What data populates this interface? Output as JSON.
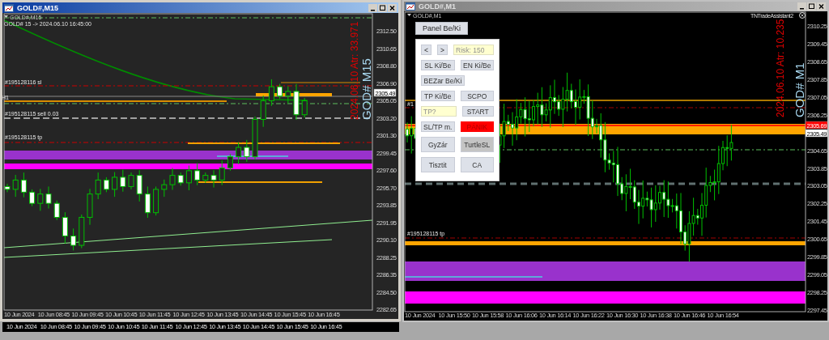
{
  "windows": [
    {
      "kind": "m15",
      "title": "GOLD#,M15",
      "active": true,
      "chart_label": "GOLD#,M15",
      "info": "GOLD# 15 -> 2024.06.10 16:45:00",
      "order_labels": [
        "#195128116 sl",
        "H1",
        "#195128115 sell 0.03",
        "#195128115 tp"
      ],
      "atr_text": "2024.06.10 Atr: 33.971",
      "symbol_text": "GOD# M15",
      "price_labels": [
        {
          "kind": "bid",
          "text": "2305.49"
        }
      ],
      "price_ticks": [
        "2312.50",
        "2310.65",
        "2308.80",
        "2306.90",
        "2305.05",
        "2303.20",
        "2301.30",
        "2299.45",
        "2297.60",
        "2295.70",
        "2293.85",
        "2291.95",
        "2290.10",
        "2288.25",
        "2286.35",
        "2284.50",
        "2282.65"
      ],
      "time_ticks": [
        "10 Jun 2024",
        "10 Jun 08:45",
        "10 Jun 09:45",
        "10 Jun 10:45",
        "10 Jun 11:45",
        "10 Jun 12:45",
        "10 Jun 13:45",
        "10 Jun 14:45",
        "10 Jun 15:45",
        "10 Jun 16:45"
      ]
    },
    {
      "kind": "m1",
      "title": "GOLD#,M1",
      "active": false,
      "chart_label": "GOLD#,M1",
      "assistant_label": "TNTradeAssistant2",
      "order_labels": [
        "#1",
        "#195128115 tp"
      ],
      "atr_text": "2024.06.10 Atr: 10.235",
      "symbol_text": "GOD# M1",
      "price_labels": [
        {
          "kind": "ask",
          "text": "2305.69"
        },
        {
          "kind": "bid",
          "text": "2305.49"
        }
      ],
      "price_ticks": [
        "2310.25",
        "2309.45",
        "2308.65",
        "2307.85",
        "2307.05",
        "2306.25",
        "2304.65",
        "2303.85",
        "2303.05",
        "2302.25",
        "2301.45",
        "2300.65",
        "2299.85",
        "2299.05",
        "2298.25",
        "2297.45"
      ],
      "time_ticks": [
        "10 Jun 2024",
        "10 Jun 15:50",
        "10 Jun 15:58",
        "10 Jun 16:06",
        "10 Jun 16:14",
        "10 Jun 16:22",
        "10 Jun 16:30",
        "10 Jun 16:38",
        "10 Jun 16:46",
        "10 Jun 16:54"
      ],
      "panel_toggle": "Panel Be/Ki",
      "panel_rows": [
        [
          {
            "kind": "button",
            "text": "<",
            "pressed": false
          },
          {
            "kind": "button",
            "text": ">",
            "pressed": false
          },
          {
            "kind": "field",
            "value": "Risk: 150"
          }
        ],
        [
          {
            "kind": "button",
            "text": "SL Ki/Be",
            "pressed": false
          },
          {
            "kind": "button",
            "text": "EN Ki/Be",
            "pressed": false
          }
        ],
        [
          {
            "kind": "button",
            "text": "BEZar Be/Ki",
            "pressed": false
          }
        ],
        [
          {
            "kind": "button",
            "text": "TP Ki/Be",
            "pressed": false
          },
          {
            "kind": "button",
            "text": "SCPO",
            "pressed": false
          }
        ],
        [
          {
            "kind": "field",
            "value": "TP?"
          },
          {
            "kind": "button",
            "text": "START",
            "pressed": false
          }
        ],
        [
          {
            "kind": "button",
            "text": "SL/TP m.",
            "pressed": false
          },
          {
            "kind": "danger",
            "text": "PÁNIK",
            "pressed": false
          }
        ],
        [
          {
            "kind": "button",
            "text": "GyZár",
            "pressed": false
          },
          {
            "kind": "button",
            "text": "TurtleSL",
            "pressed": true
          }
        ],
        [
          {
            "kind": "button",
            "text": "Tisztit",
            "pressed": false
          },
          {
            "kind": "button",
            "text": "CA",
            "pressed": false
          }
        ]
      ]
    }
  ],
  "background_time_ticks": [
    "10 Jun 2024",
    "10 Jun 08:45",
    "10 Jun 09:45",
    "10 Jun 10:45",
    "10 Jun 11:45",
    "10 Jun 12:45",
    "10 Jun 13:45",
    "10 Jun 14:45",
    "10 Jun 15:45",
    "10 Jun 16:45"
  ]
}
